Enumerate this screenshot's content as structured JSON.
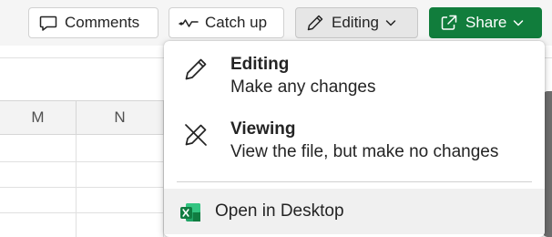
{
  "toolbar": {
    "comments_label": "Comments",
    "catchup_label": "Catch up",
    "editing_label": "Editing",
    "share_label": "Share"
  },
  "columns": [
    "M",
    "N"
  ],
  "menu": {
    "items": [
      {
        "title": "Editing",
        "subtitle": "Make any changes",
        "icon": "pencil-icon"
      },
      {
        "title": "Viewing",
        "subtitle": "View the file, but make no changes",
        "icon": "pencil-off-icon"
      }
    ],
    "open_desktop_label": "Open in Desktop",
    "open_desktop_icon": "excel-icon"
  },
  "colors": {
    "share_green": "#117d3c",
    "excel_green": "#107c41",
    "toolbar_bg": "#f5f5f5"
  }
}
